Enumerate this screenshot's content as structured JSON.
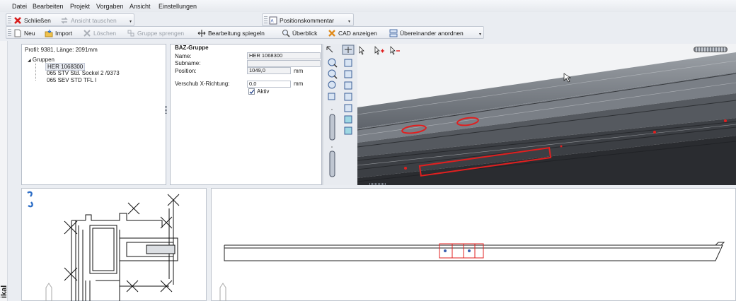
{
  "menu": [
    "Datei",
    "Bearbeiten",
    "Projekt",
    "Vorgaben",
    "Ansicht",
    "Einstellungen"
  ],
  "toolbar1": {
    "close": "Schließen",
    "swap": "Ansicht tauschen",
    "comment": "Positionskommentar"
  },
  "toolbar2": {
    "new": "Neu",
    "import": "Import",
    "delete": "Löschen",
    "ungroup": "Gruppe sprengen",
    "mirror": "Bearbeitung spiegeln",
    "overview": "Überblick",
    "cad": "CAD anzeigen",
    "arrange": "Übereinander anordnen"
  },
  "tree": {
    "header": "Profil: 9381, Länge: 2091mm",
    "root": "Gruppen",
    "items": [
      "HER 1068300",
      "065 STV Std. Sockel 2 /9373",
      "065 SEV STD TFL I"
    ]
  },
  "props": {
    "title": "BAZ-Gruppe",
    "name_label": "Name:",
    "name_value": "HER 1068300",
    "subname_label": "Subname:",
    "subname_value": "",
    "position_label": "Position:",
    "position_value": "1049,0",
    "position_unit": "mm",
    "shift_label": "Verschub X-Richtung:",
    "shift_value": "0,0",
    "shift_unit": "mm",
    "active_label": "Aktiv",
    "active": true
  },
  "colors": {
    "accent": "#e02020",
    "window_bg": "#eaedf2",
    "panel_border": "#b7bec9"
  },
  "icons": [
    "close-icon",
    "swap-icon",
    "comment-icon",
    "new-icon",
    "import-icon",
    "delete-icon",
    "ungroup-icon",
    "mirror-icon",
    "overview-icon",
    "cad-icon",
    "arrange-icon"
  ]
}
